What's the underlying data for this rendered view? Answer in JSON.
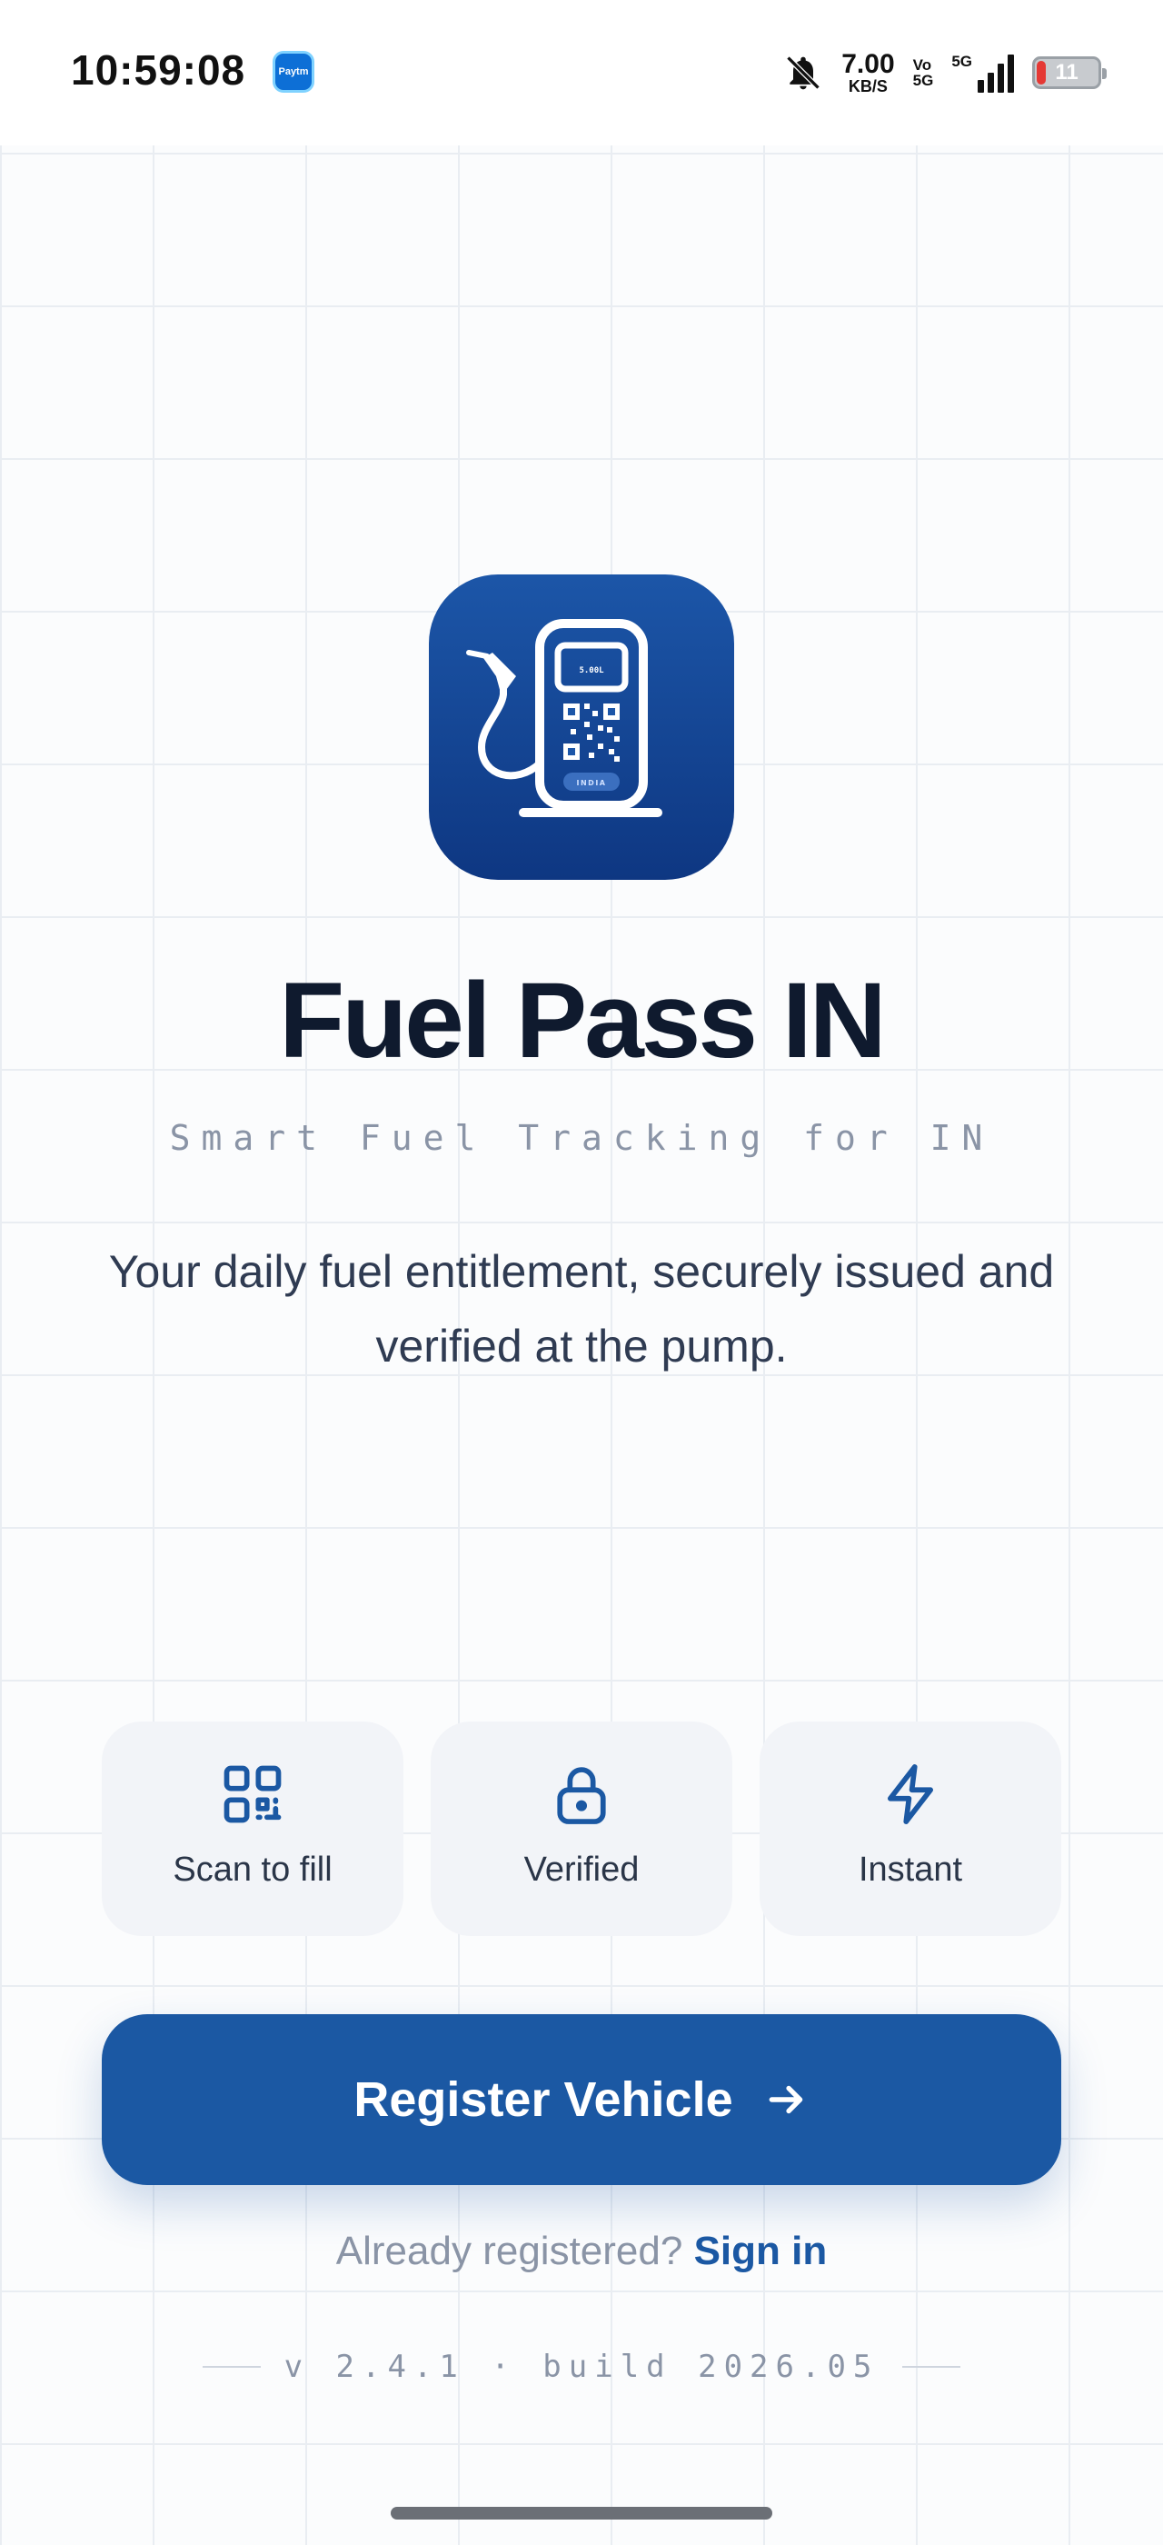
{
  "status_bar": {
    "time": "10:59:08",
    "paytm_label": "Paytm",
    "speed_value": "7.00",
    "speed_unit": "KB/S",
    "vo_top": "Vo",
    "vo_bottom": "5G",
    "network_label": "5G",
    "battery_level": "11"
  },
  "app": {
    "icon_display": "5.00L",
    "icon_badge": "INDIA",
    "title": "Fuel Pass IN",
    "subtitle": "Smart Fuel Tracking for IN",
    "tagline": "Your daily fuel entitlement, securely issued and verified at the pump."
  },
  "features": [
    {
      "label": "Scan to fill",
      "icon": "qr-code-icon"
    },
    {
      "label": "Verified",
      "icon": "lock-icon"
    },
    {
      "label": "Instant",
      "icon": "lightning-icon"
    }
  ],
  "cta": {
    "label": "Register Vehicle"
  },
  "signin": {
    "prompt": "Already registered?",
    "link": "Sign in"
  },
  "version": "v 2.4.1 · build 2026.05",
  "colors": {
    "brand": "#1b58a3",
    "title": "#0f1a2e",
    "muted": "#8a94a6",
    "card": "#f2f4f8"
  }
}
